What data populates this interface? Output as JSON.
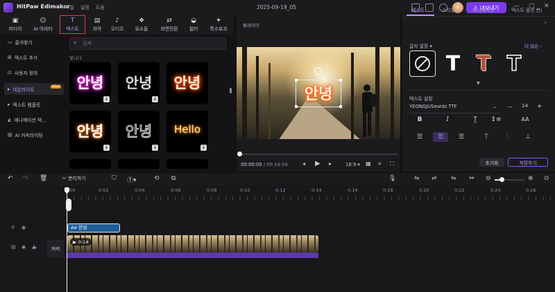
{
  "app": {
    "name": "HitPaw Edimakor",
    "menus": [
      "파일",
      "설정",
      "도움"
    ],
    "title": "2025-09-19_05",
    "export_label": "내보내기",
    "accent": "#7c3aed"
  },
  "tool_tabs": [
    {
      "label": "미디어",
      "icon": "media-icon"
    },
    {
      "label": "AI 아바타",
      "icon": "avatar-icon"
    },
    {
      "label": "텍스트",
      "icon": "text-icon",
      "active": true
    },
    {
      "label": "자막",
      "icon": "subtitle-icon"
    },
    {
      "label": "오디오",
      "icon": "music-icon"
    },
    {
      "label": "요소들",
      "icon": "elements-icon"
    },
    {
      "label": "화면전환",
      "icon": "transition-icon"
    },
    {
      "label": "필터",
      "icon": "filter-icon"
    },
    {
      "label": "특수효과",
      "icon": "effects-icon"
    }
  ],
  "sidebar": {
    "items": [
      {
        "label": "즐겨찾기",
        "icon": "folder-icon"
      },
      {
        "label": "텍스트 추가",
        "icon": "text-add-icon"
      },
      {
        "label": "사용자 정의",
        "icon": "custom-icon"
      },
      {
        "label": "네온라이트",
        "icon": "neon-icon",
        "active": true,
        "badge": "NEW"
      },
      {
        "label": "텍스트 템플릿",
        "icon": "template-icon"
      },
      {
        "label": "애니메이션 텍...",
        "icon": "animation-icon"
      },
      {
        "label": "AI 카피라이팅",
        "icon": "ai-icon"
      }
    ]
  },
  "search": {
    "placeholder": "검색",
    "value": ""
  },
  "section_label": "빛나다",
  "presets": [
    {
      "text": "안녕",
      "color": "#ffffff",
      "glow": "#ff2bd6"
    },
    {
      "text": "안녕",
      "color": "#f4f4f4",
      "glow": "#c8c8c8"
    },
    {
      "text": "안녕",
      "color": "#fff1d0",
      "glow": "#ff3a1f"
    },
    {
      "text": "안녕",
      "color": "#ffffff",
      "glow": "#ff7a1a"
    },
    {
      "text": "안녕",
      "color": "#e6e6e6",
      "glow": "#555555"
    },
    {
      "text": "Hello",
      "color": "#ffe6a8",
      "glow": "#ff8c00"
    }
  ],
  "player": {
    "title": "플레이어",
    "overlay_text": "안녕",
    "current_time": "00:00:00",
    "total_time": "00:14:04",
    "aspect_ratio": "16:9"
  },
  "right_panel": {
    "tabs": [
      "텍스트",
      "스타일",
      "애니메이션",
      "텍스트 음성 변환"
    ],
    "font_preset_label": "글자 설정",
    "more_label": "더 많은",
    "text_settings_label": "텍스트 설정",
    "font_name": "YEONGJUSeonbi TTF",
    "font_size": "14",
    "reset_label": "초기화",
    "save_label": "저장하기"
  },
  "timeline": {
    "split_label": "분리하기",
    "ruler": [
      "0:00",
      "0:02",
      "0:04",
      "0:06",
      "0:08",
      "0:10",
      "0:12",
      "0:14",
      "0:16",
      "0:18",
      "0:20",
      "0:22",
      "0:24",
      "0:26"
    ],
    "text_clip_label": "Aa 안녕",
    "video_clip_duration": "0:14",
    "cover_label": "커버",
    "playhead_time": "0:00",
    "zoom_fraction": 0.2
  }
}
